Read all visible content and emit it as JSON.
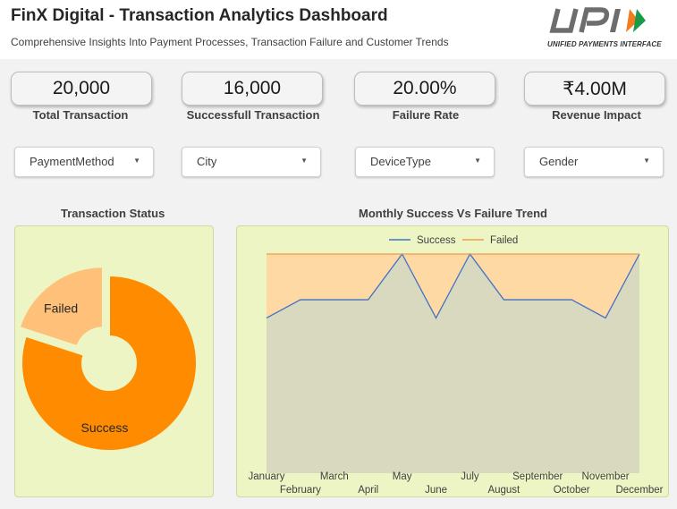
{
  "header": {
    "title": "FinX Digital - Transaction Analytics Dashboard",
    "subtitle": "Comprehensive Insights Into Payment Processes, Transaction Failure and Customer Trends",
    "logo_caption": "UNIFIED PAYMENTS INTERFACE"
  },
  "kpis": [
    {
      "value": "20,000",
      "label": "Total Transaction"
    },
    {
      "value": "16,000",
      "label": "Successfull Transaction"
    },
    {
      "value": "20.00%",
      "label": "Failure Rate"
    },
    {
      "value": "₹4.00M",
      "label": "Revenue Impact"
    }
  ],
  "filters": [
    {
      "label": "PaymentMethod"
    },
    {
      "label": "City"
    },
    {
      "label": "DeviceType"
    },
    {
      "label": "Gender"
    }
  ],
  "colors": {
    "success": "#ff8c00",
    "failed": "#ffc07a",
    "success_line": "#4472c4",
    "failed_line": "#ed9b4a",
    "panel": "#eef5c4"
  },
  "chart_data": [
    {
      "type": "pie",
      "title": "Transaction Status",
      "labels": [
        "Failed",
        "Success"
      ],
      "values": [
        4000,
        16000
      ],
      "donut": true,
      "legend": "none"
    },
    {
      "type": "area",
      "title": "Monthly Success Vs Failure Trend",
      "categories": [
        "January",
        "February",
        "March",
        "April",
        "May",
        "June",
        "July",
        "August",
        "September",
        "October",
        "November",
        "December"
      ],
      "series": [
        {
          "name": "Success",
          "values": [
            1320,
            1340,
            1340,
            1340,
            1390,
            1320,
            1390,
            1340,
            1340,
            1340,
            1320,
            1390
          ]
        },
        {
          "name": "Failed",
          "values": [
            70,
            50,
            50,
            50,
            0,
            70,
            0,
            50,
            50,
            50,
            70,
            0
          ]
        }
      ],
      "stacked": true,
      "legend": "top-center",
      "grid": false,
      "ylim": [
        1150,
        1390
      ]
    }
  ]
}
